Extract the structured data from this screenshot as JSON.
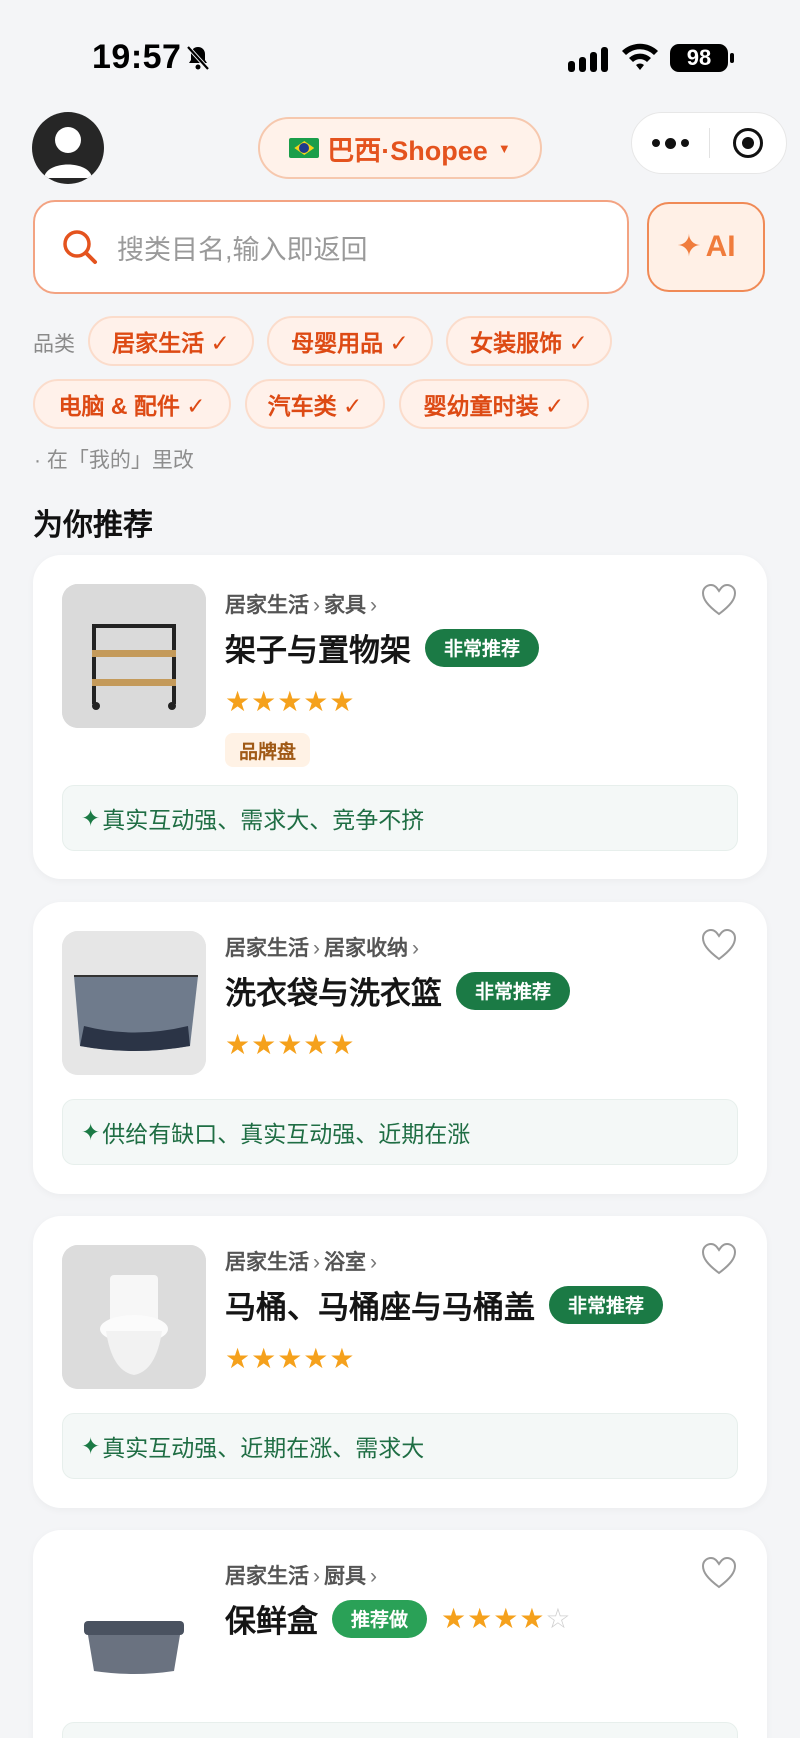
{
  "status_bar": {
    "time": "19:57",
    "battery": "98"
  },
  "header": {
    "region": "巴西·Shopee",
    "region_caret": "▼",
    "flag_icon": "brazil-flag-icon"
  },
  "search": {
    "placeholder": "搜类目名,输入即返回",
    "ai_label": "AI",
    "ai_spark": "✦"
  },
  "categories": {
    "label": "品类",
    "chips": [
      "居家生活 ✓",
      "母婴用品 ✓",
      "女装服饰 ✓",
      "电脑 & 配件 ✓",
      "汽车类 ✓",
      "婴幼童时装 ✓"
    ],
    "hint": "· 在「我的」里改"
  },
  "section_title": "为你推荐",
  "cards": [
    {
      "crumb_main": "居家生活",
      "crumb_sub": "家具",
      "title": "架子与置物架",
      "badge": "非常推荐",
      "stars": "★★★★★",
      "stars_off": "",
      "tag": "品牌盘",
      "reason_spark": "✦",
      "reason": "真实互动强、需求大、竞争不挤"
    },
    {
      "crumb_main": "居家生活",
      "crumb_sub": "居家收纳",
      "title": "洗衣袋与洗衣篮",
      "badge": "非常推荐",
      "stars": "★★★★★",
      "stars_off": "",
      "reason_spark": "✦",
      "reason": "供给有缺口、真实互动强、近期在涨"
    },
    {
      "crumb_main": "居家生活",
      "crumb_sub": "浴室",
      "title": "马桶、马桶座与马桶盖",
      "badge": "非常推荐",
      "stars": "★★★★★",
      "stars_off": "",
      "reason_spark": "✦",
      "reason": "真实互动强、近期在涨、需求大"
    },
    {
      "crumb_main": "居家生活",
      "crumb_sub": "厨具",
      "title": "保鲜盒",
      "badge": "推荐做",
      "stars": "★★★★",
      "stars_off": "☆"
    }
  ],
  "arrow": "›"
}
